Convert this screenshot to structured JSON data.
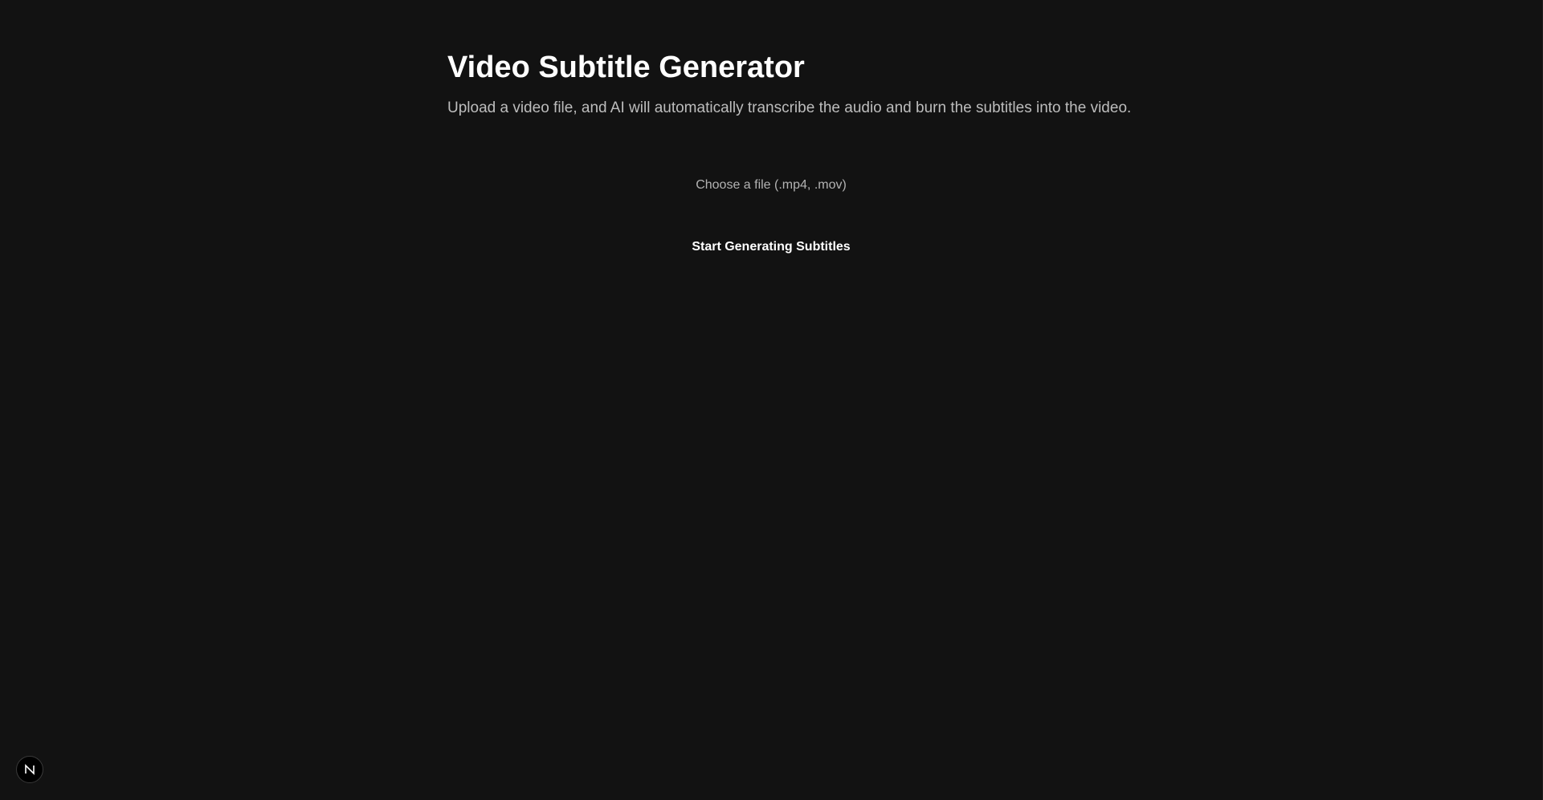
{
  "header": {
    "title": "Video Subtitle Generator",
    "subtitle": "Upload a video file, and AI will automatically transcribe the audio and burn the subtitles into the video."
  },
  "upload": {
    "file_label": "Choose a file (.mp4, .mov)",
    "accept": ".mp4,.mov"
  },
  "actions": {
    "generate_label": "Start Generating Subtitles"
  },
  "dev_indicator": {
    "icon": "nextjs-logo-icon"
  },
  "colors": {
    "background": "#121212",
    "title_text": "#ffffff",
    "subtitle_text": "#bdbdbd",
    "file_label_text": "#b3b3b3",
    "button_text": "#ffffff"
  }
}
